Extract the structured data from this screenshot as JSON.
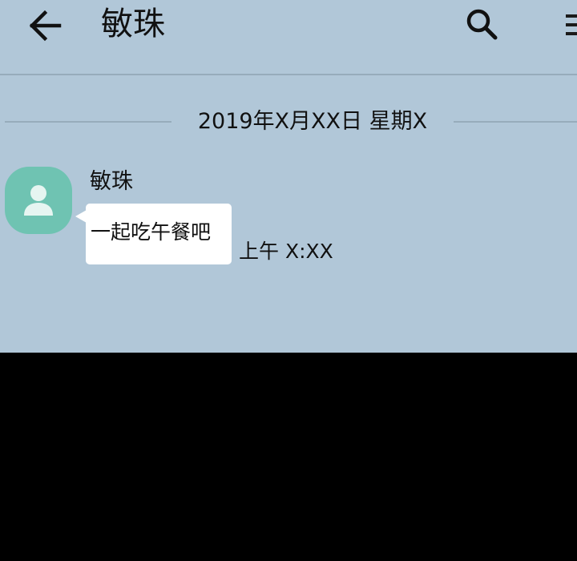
{
  "header": {
    "title": "敏珠",
    "back_icon": "arrow-left-icon",
    "search_icon": "search-icon",
    "menu_icon": "hamburger-menu-icon"
  },
  "date_separator": {
    "text": "2019年X月XX日 星期X"
  },
  "messages": [
    {
      "sender": "敏珠",
      "avatar_icon": "person-icon",
      "text": "一起吃午餐吧",
      "time": "上午 X:XX"
    }
  ],
  "colors": {
    "background": "#b1c7d8",
    "divider": "#97acbb",
    "avatar": "#6fc3b2",
    "bubble": "#ffffff",
    "lower_area": "#000000"
  }
}
